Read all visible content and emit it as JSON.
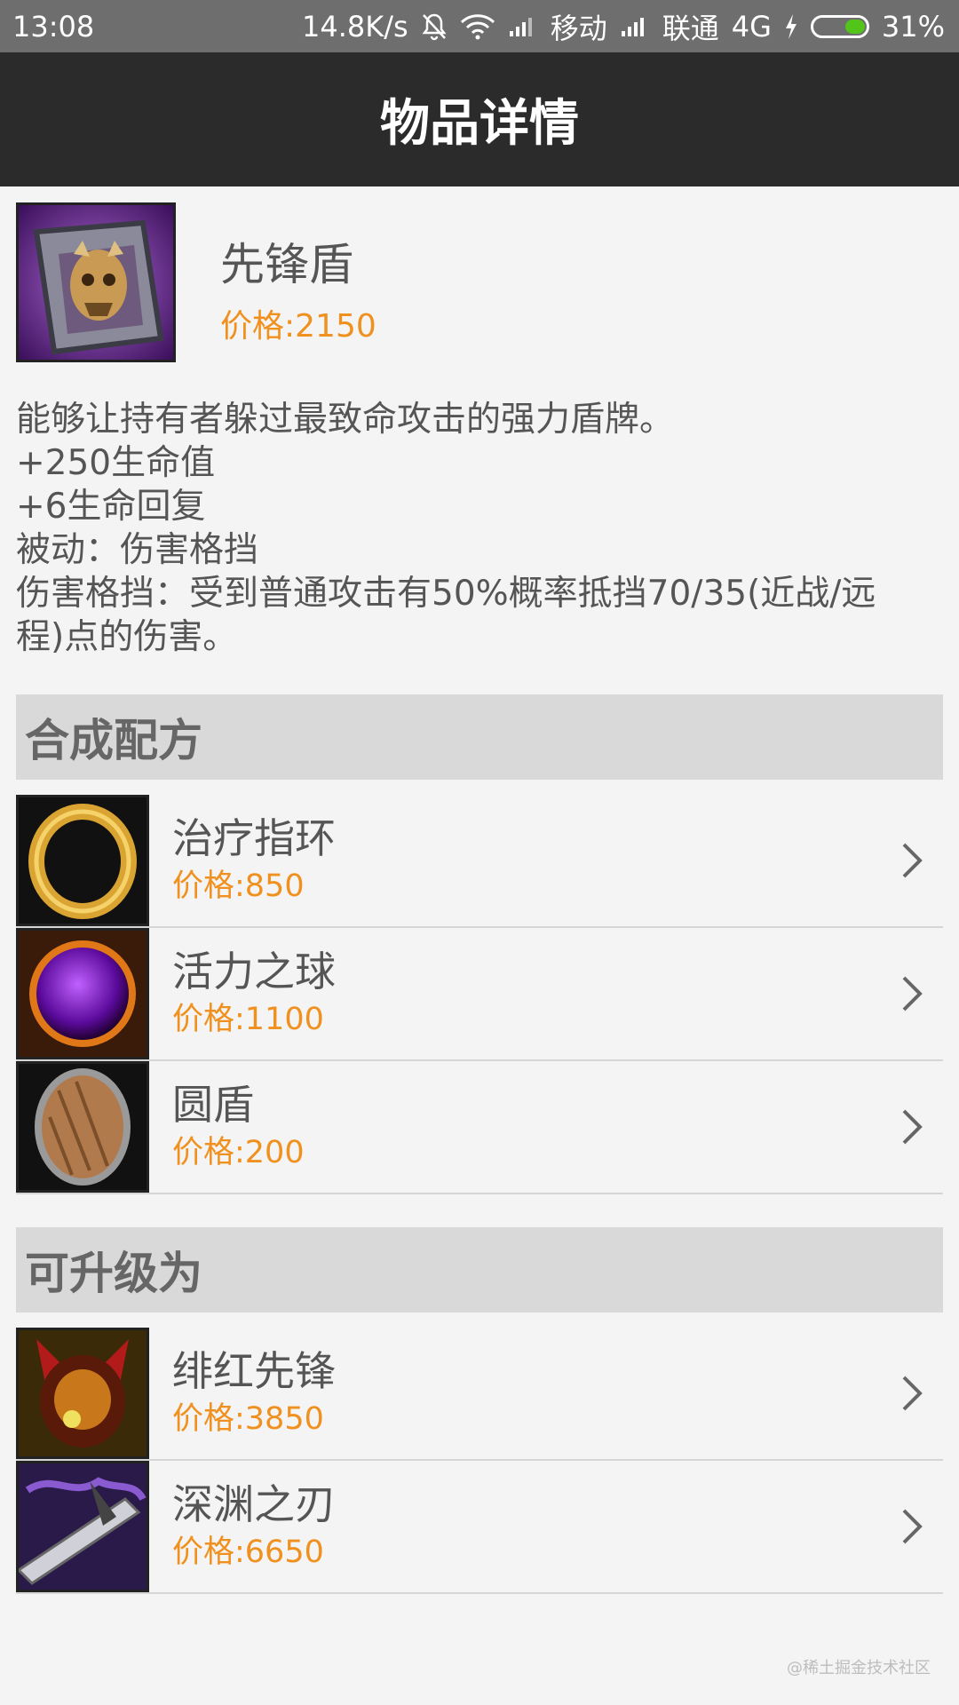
{
  "status_bar": {
    "time": "13:08",
    "net_speed": "14.8K/s",
    "carrier1": "移动",
    "carrier2": "联通",
    "network": "4G",
    "battery": "31%"
  },
  "title_bar": {
    "title": "物品详情"
  },
  "item": {
    "name": "先锋盾",
    "price": "价格:2150",
    "description": [
      "能够让持有者躲过最致命攻击的强力盾牌。",
      "+250生命值",
      "+6生命回复",
      "被动：伤害格挡",
      "伤害格挡：受到普通攻击有50%概率抵挡70/35(近战/远",
      "程)点的伤害。"
    ]
  },
  "recipe": {
    "header": "合成配方",
    "items": [
      {
        "name": "治疗指环",
        "price": "价格:850",
        "icon": "ring-icon"
      },
      {
        "name": "活力之球",
        "price": "价格:1100",
        "icon": "orb-icon"
      },
      {
        "name": "圆盾",
        "price": "价格:200",
        "icon": "round-shield-icon"
      }
    ]
  },
  "upgrades": {
    "header": "可升级为",
    "items": [
      {
        "name": "绯红先锋",
        "price": "价格:3850",
        "icon": "crimson-guard-icon"
      },
      {
        "name": "深渊之刃",
        "price": "价格:6650",
        "icon": "abyssal-blade-icon"
      }
    ]
  },
  "watermark": "@稀土掘金技术社区",
  "colors": {
    "price": "#f0901e",
    "title_bg": "#2b2b2b",
    "status_bg": "#6e6e6e",
    "section_bg": "#d9d9d9"
  }
}
